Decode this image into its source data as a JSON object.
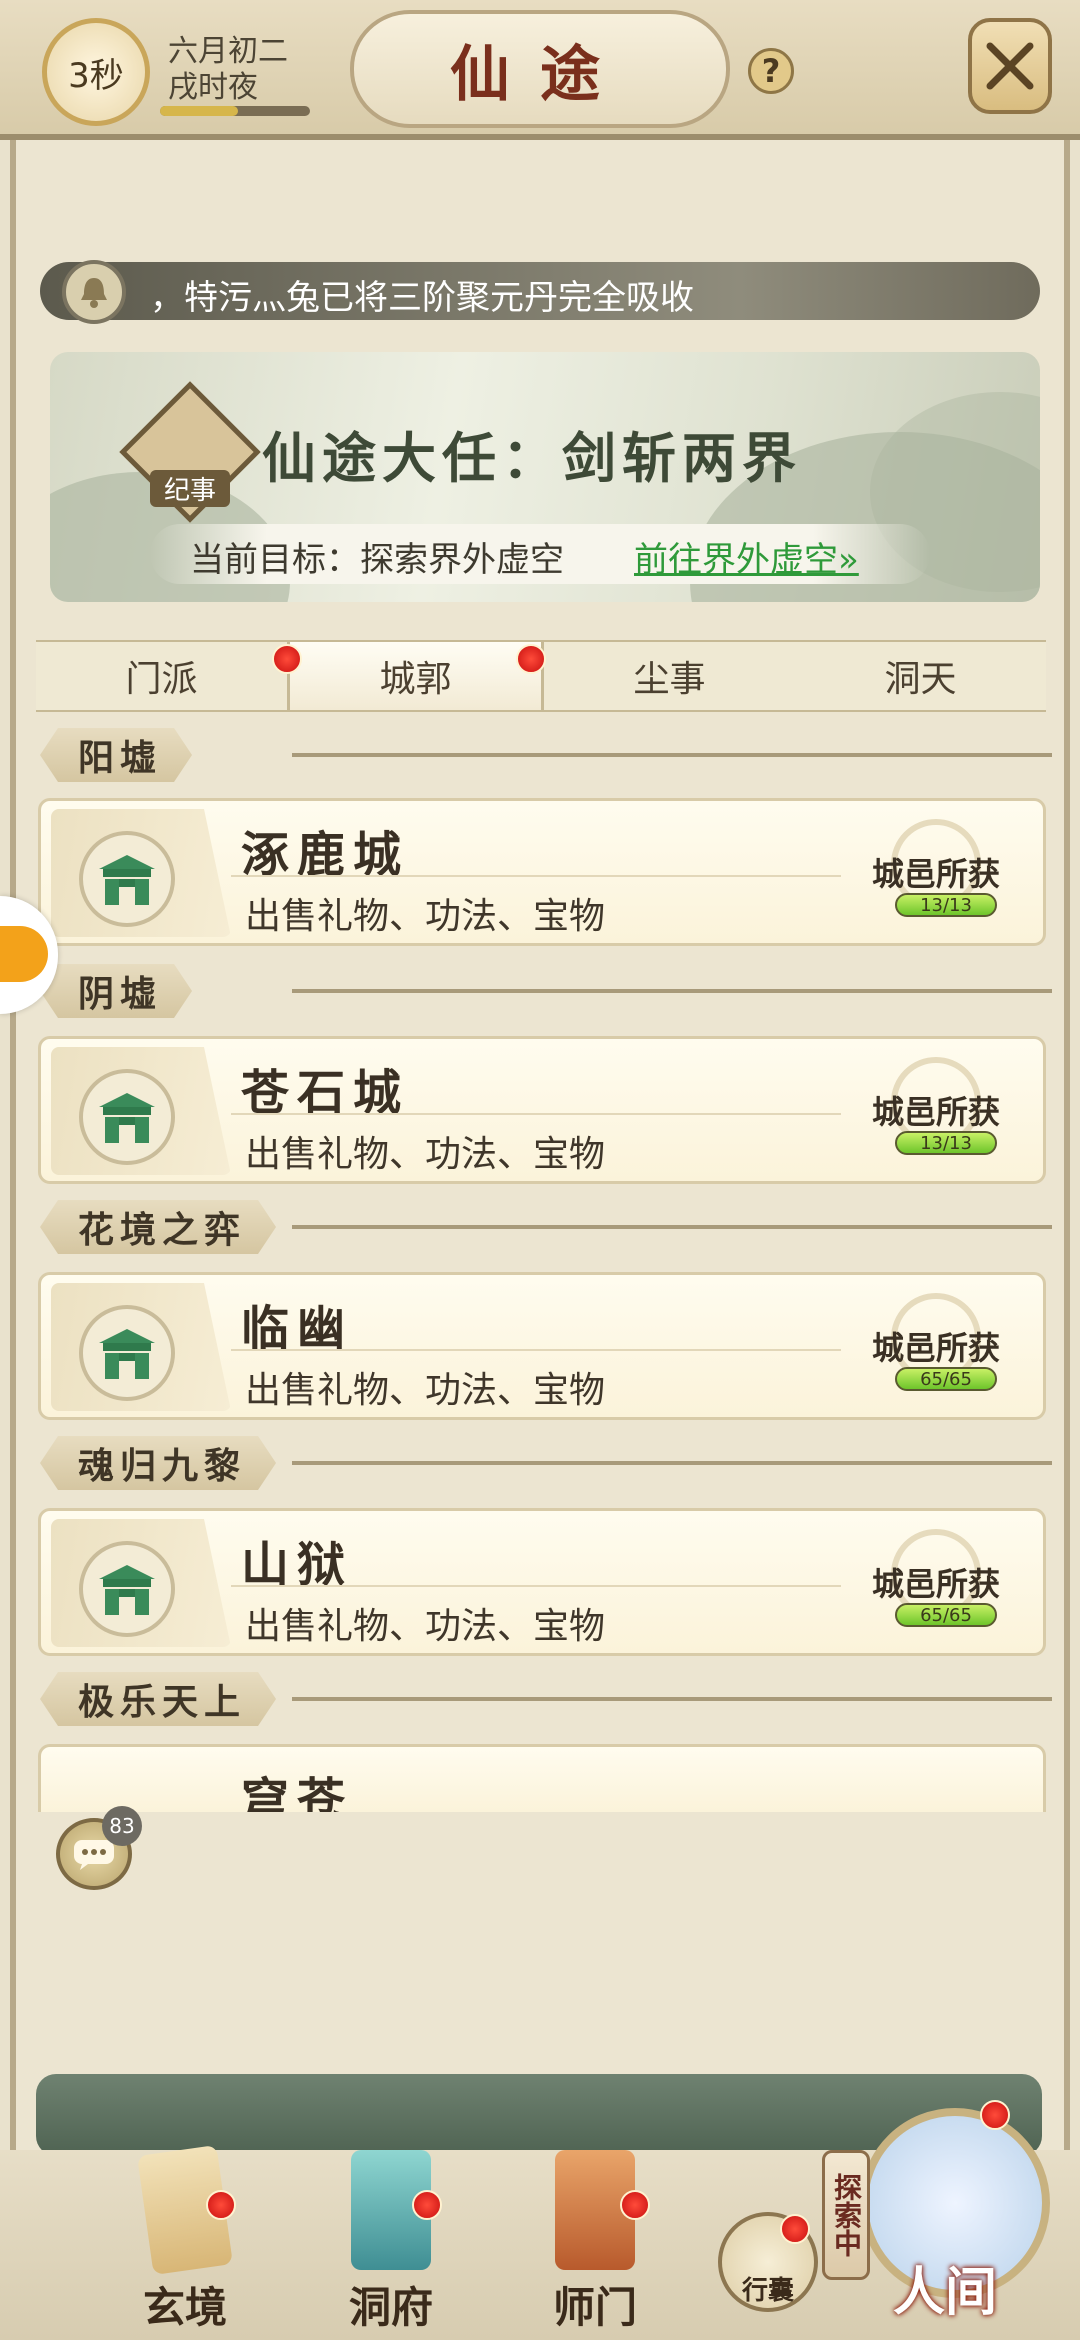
{
  "header": {
    "timer": "3秒",
    "date_line1": "六月初二",
    "date_line2": "戌时夜",
    "title": "仙途",
    "help": "?"
  },
  "announcement": {
    "text": "，特污灬兔已将三阶聚元丹完全吸收"
  },
  "quest": {
    "emblem_label": "纪事",
    "title": "仙途大任：剑斩两界",
    "goal": "当前目标：探索界外虚空",
    "link": "前往界外虚空»"
  },
  "tabs": [
    {
      "label": "门派",
      "dot": true
    },
    {
      "label": "城郭",
      "dot": true,
      "active": true
    },
    {
      "label": "尘事",
      "dot": false
    },
    {
      "label": "洞天",
      "dot": false
    }
  ],
  "sections": [
    {
      "name": "阳墟",
      "city": {
        "name": "涿鹿城",
        "desc": "出售礼物、功法、宝物",
        "badge": "城邑所获",
        "progress": "13/13"
      }
    },
    {
      "name": "阴墟",
      "city": {
        "name": "苍石城",
        "desc": "出售礼物、功法、宝物",
        "badge": "城邑所获",
        "progress": "13/13"
      }
    },
    {
      "name": "花境之弈",
      "city": {
        "name": "临幽",
        "desc": "出售礼物、功法、宝物",
        "badge": "城邑所获",
        "progress": "65/65"
      }
    },
    {
      "name": "魂归九黎",
      "city": {
        "name": "山狱",
        "desc": "出售礼物、功法、宝物",
        "badge": "城邑所获",
        "progress": "65/65"
      }
    },
    {
      "name": "极乐天上",
      "city": {
        "name": "穹苍",
        "desc": "",
        "badge": "",
        "progress": ""
      }
    }
  ],
  "chat": {
    "count": "83"
  },
  "bottom_nav": [
    {
      "label": "玄境",
      "dot": true
    },
    {
      "label": "洞府",
      "dot": true
    },
    {
      "label": "师门",
      "dot": true
    }
  ],
  "bag": {
    "label": "行囊"
  },
  "exploring": {
    "label": "探索中"
  },
  "world": {
    "label": "人间"
  },
  "colors": {
    "accent_red": "#c80f0f",
    "link_green": "#2f9a3a",
    "progress_green": "#6ec52b"
  }
}
